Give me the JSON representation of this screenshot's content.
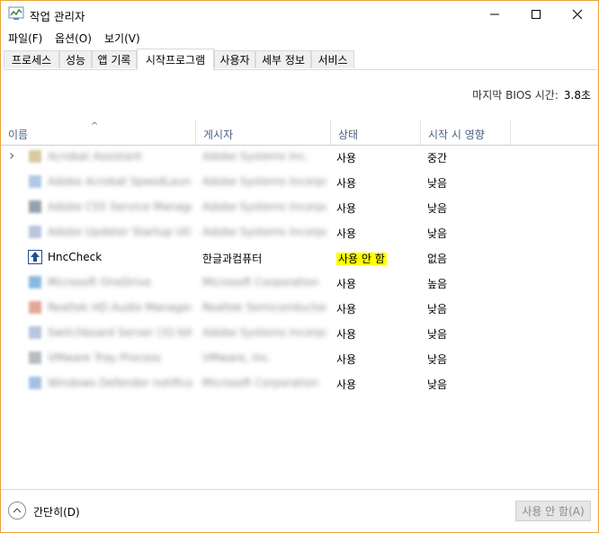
{
  "window": {
    "title": "작업 관리자"
  },
  "menu": [
    "파일(F)",
    "옵션(O)",
    "보기(V)"
  ],
  "tabs": [
    "프로세스",
    "성능",
    "앱 기록",
    "시작프로그램",
    "사용자",
    "세부 정보",
    "서비스"
  ],
  "active_tab": "시작프로그램",
  "bios": {
    "label": "마지막 BIOS 시간:",
    "value": "3.8초"
  },
  "columns": {
    "name": "이름",
    "publisher": "게시자",
    "status": "상태",
    "impact": "시작 시 영향"
  },
  "rows": [
    {
      "name": "Acrobat Assistant",
      "publisher": "Adobe Systems Inc.",
      "status": "사용",
      "impact": "중간",
      "blurred": true,
      "icon_color": "#c9b27a"
    },
    {
      "name": "Adobe Acrobat SpeedLaunch",
      "publisher": "Adobe Systems Incorporated",
      "status": "사용",
      "impact": "낮음",
      "blurred": true,
      "icon_color": "#8fb3d9"
    },
    {
      "name": "Adobe CS5 Service Manager",
      "publisher": "Adobe Systems Incorporated",
      "status": "사용",
      "impact": "낮음",
      "blurred": true,
      "icon_color": "#6a7b8c"
    },
    {
      "name": "Adobe Updater Startup Utility",
      "publisher": "Adobe Systems Incorporated",
      "status": "사용",
      "impact": "낮음",
      "blurred": true,
      "icon_color": "#9aaed0"
    },
    {
      "name": "HncCheck",
      "publisher": "한글과컴퓨터",
      "status": "사용 안 함",
      "impact": "없음",
      "blurred": false,
      "icon_color": "#1f4f8f"
    },
    {
      "name": "Microsoft OneDrive",
      "publisher": "Microsoft Corporation",
      "status": "사용",
      "impact": "높음",
      "blurred": true,
      "icon_color": "#5b9bd5"
    },
    {
      "name": "Realtek HD Audio Manager",
      "publisher": "Realtek Semiconductor",
      "status": "사용",
      "impact": "낮음",
      "blurred": true,
      "icon_color": "#d9826b"
    },
    {
      "name": "Switchboard Server (32-bit)",
      "publisher": "Adobe Systems Incorporated",
      "status": "사용",
      "impact": "낮음",
      "blurred": true,
      "icon_color": "#9aaed0"
    },
    {
      "name": "VMware Tray Process",
      "publisher": "VMware, Inc.",
      "status": "사용",
      "impact": "낮음",
      "blurred": true,
      "icon_color": "#9aa0a6"
    },
    {
      "name": "Windows Defender notification",
      "publisher": "Microsoft Corporation",
      "status": "사용",
      "impact": "낮음",
      "blurred": true,
      "icon_color": "#7fa7d6"
    }
  ],
  "footer": {
    "collapse_label": "간단히(D)",
    "disable_button": "사용 안 함(A)"
  },
  "colors": {
    "border": "#e8a33c",
    "highlight": "#ffff00",
    "header_text": "#4d6082"
  }
}
